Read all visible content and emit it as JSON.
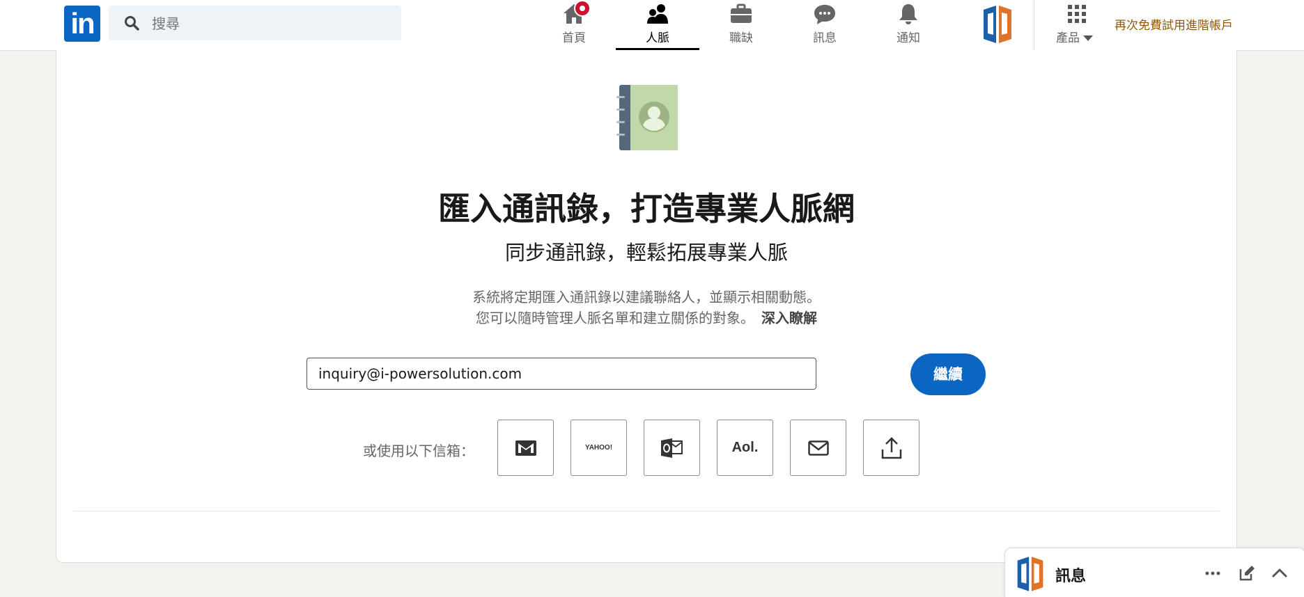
{
  "nav": {
    "search_placeholder": "搜尋",
    "items": [
      {
        "label": "首頁"
      },
      {
        "label": "人脈"
      },
      {
        "label": "職缺"
      },
      {
        "label": "訊息"
      },
      {
        "label": "通知"
      }
    ],
    "products_label": "產品",
    "premium_label": "再次免費試用進階帳戶"
  },
  "main": {
    "headline": "匯入通訊錄，打造專業人脈網",
    "subheadline": "同步通訊錄，輕鬆拓展專業人脈",
    "description_line1": "系統將定期匯入通訊錄以建議聯絡人，並顯示相關動態。",
    "description_line2": "您可以隨時管理人脈名單和建立關係的對象。",
    "learn_more": "深入瞭解",
    "email_value": "inquiry@i-powersolution.com",
    "continue_label": "繼續",
    "or_use_label": "或使用以下信箱：",
    "providers": [
      {
        "icon": "gmail-icon"
      },
      {
        "icon": "yahoo-icon",
        "text": "YAHOO!"
      },
      {
        "icon": "outlook-icon"
      },
      {
        "icon": "aol-icon",
        "text": "Aol."
      },
      {
        "icon": "mail-icon"
      },
      {
        "icon": "upload-icon"
      }
    ]
  },
  "messaging": {
    "title": "訊息"
  },
  "colors": {
    "brand_blue": "#0a66c2",
    "premium_gold": "#915907",
    "notification_red": "#cb112d"
  }
}
